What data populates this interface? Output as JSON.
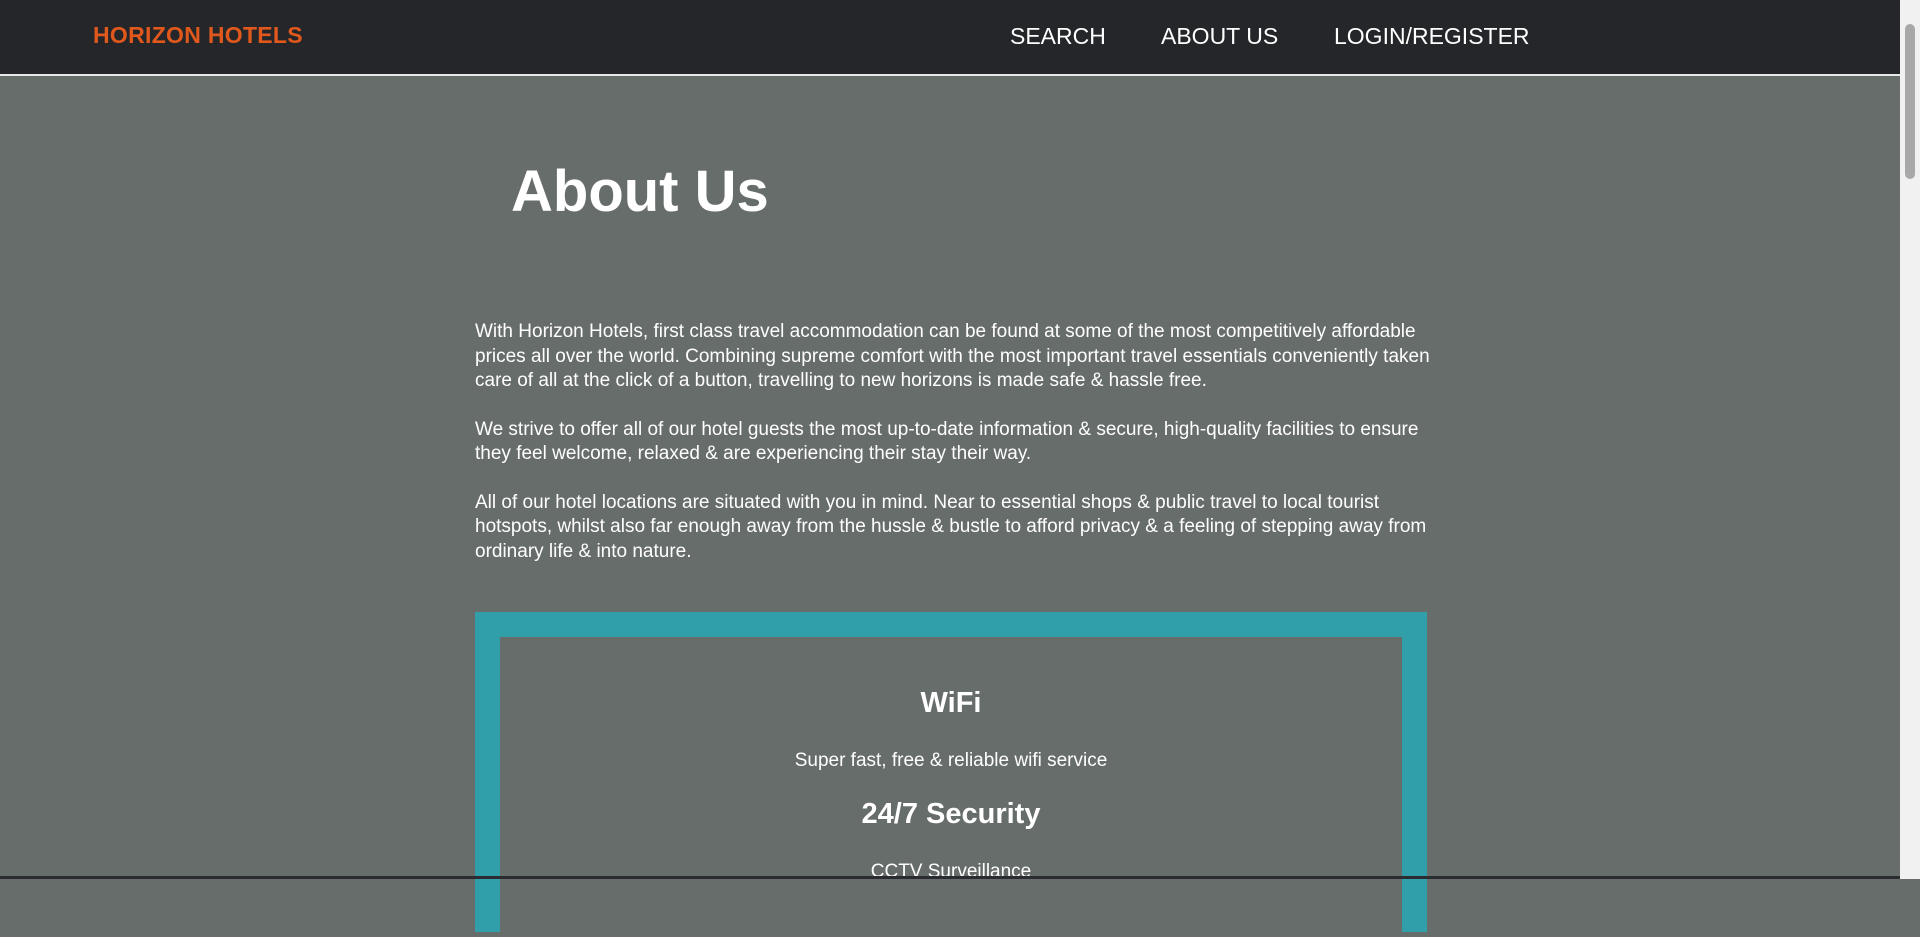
{
  "navbar": {
    "brand": "HORIZON HOTELS",
    "links": [
      "SEARCH",
      "ABOUT US",
      "LOGIN/REGISTER"
    ],
    "brand_color": "#e0581c"
  },
  "main": {
    "title": "About Us",
    "paragraphs": [
      "With Horizon Hotels, first class travel accommodation can be found at some of the most competitively affordable prices all over the world. Combining supreme comfort with the most important travel essentials conveniently taken care of all at the click of a button, travelling to new horizons is made safe & hassle free.",
      "We strive to offer all of our hotel guests the most up-to-date information & secure, high-quality facilities to ensure they feel welcome, relaxed & are experiencing their stay their way.",
      "All of our hotel locations are situated with you in mind. Near to essential shops & public travel to local tourist hotspots, whilst also far enough away from the hussle & bustle to afford privacy & a feeling of stepping away from ordinary life & into nature."
    ]
  },
  "features": {
    "border_color": "#319faa",
    "items": [
      {
        "title": "WiFi",
        "description": "Super fast, free & reliable wifi service"
      },
      {
        "title": "24/7 Security",
        "description": "CCTV Surveillance"
      }
    ]
  }
}
